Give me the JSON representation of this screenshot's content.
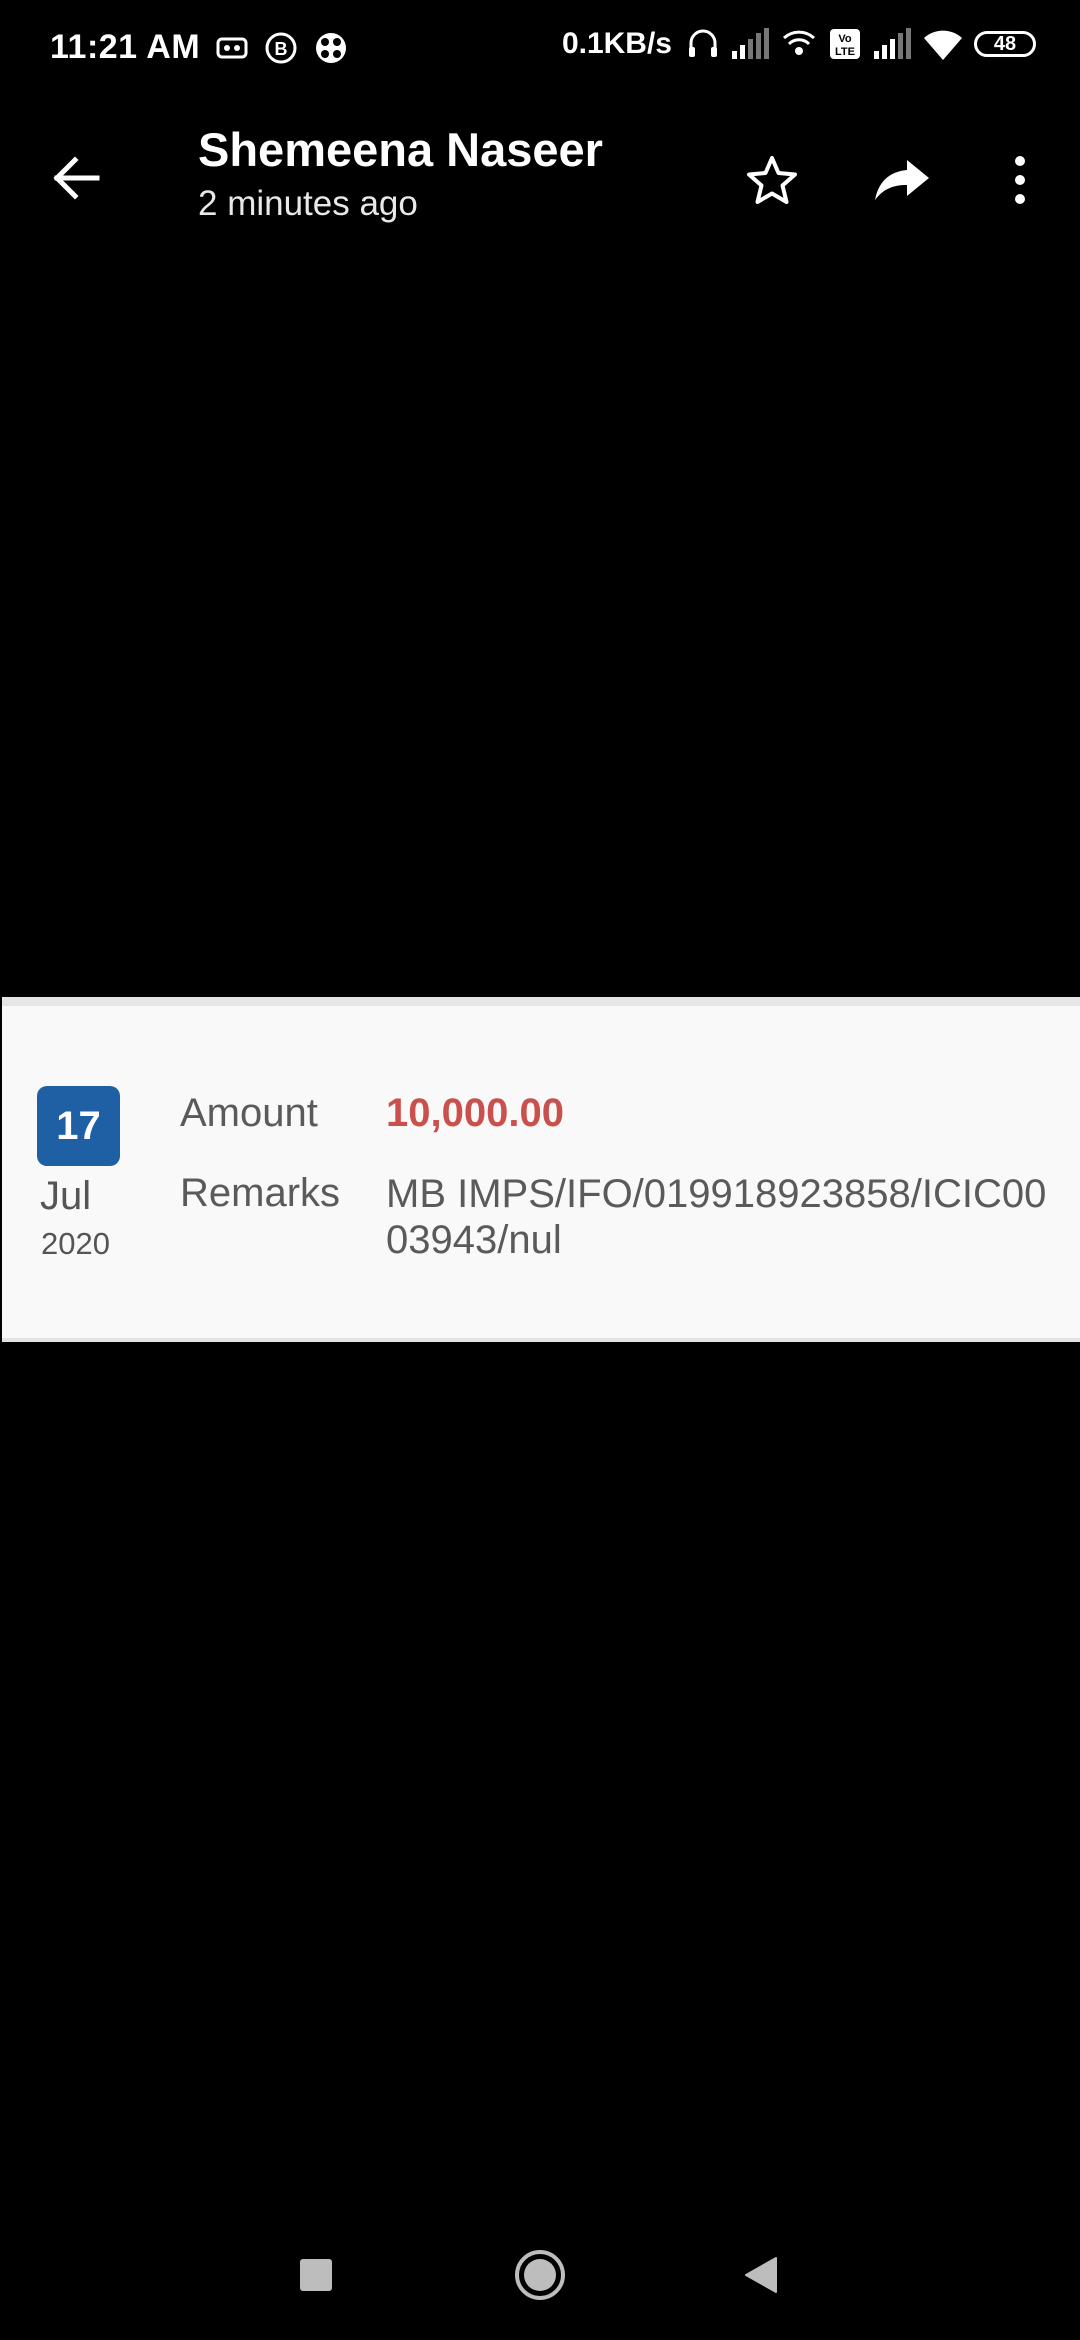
{
  "status_bar": {
    "time": "11:21 AM",
    "net_speed": "0.1KB/s",
    "battery": "48"
  },
  "app_bar": {
    "sender_name": "Shemeena Naseer",
    "sent_time": "2 minutes ago"
  },
  "transaction": {
    "date_day": "17",
    "date_month": "Jul",
    "date_year": "2020",
    "amount_label": "Amount",
    "amount_value": "10,000.00",
    "remarks_label": "Remarks",
    "remarks_value": "MB IMPS/IFO/019918923858/ICIC0003943/nul",
    "amount_color": "#c9504c",
    "badge_color": "#1f5fa3"
  },
  "icons": {
    "back": "arrow-left-icon",
    "star": "star-outline-icon",
    "forward": "forward-arrow-icon",
    "more": "more-vertical-icon",
    "nav_recents": "square-icon",
    "nav_home": "circle-icon",
    "nav_back": "triangle-back-icon"
  }
}
